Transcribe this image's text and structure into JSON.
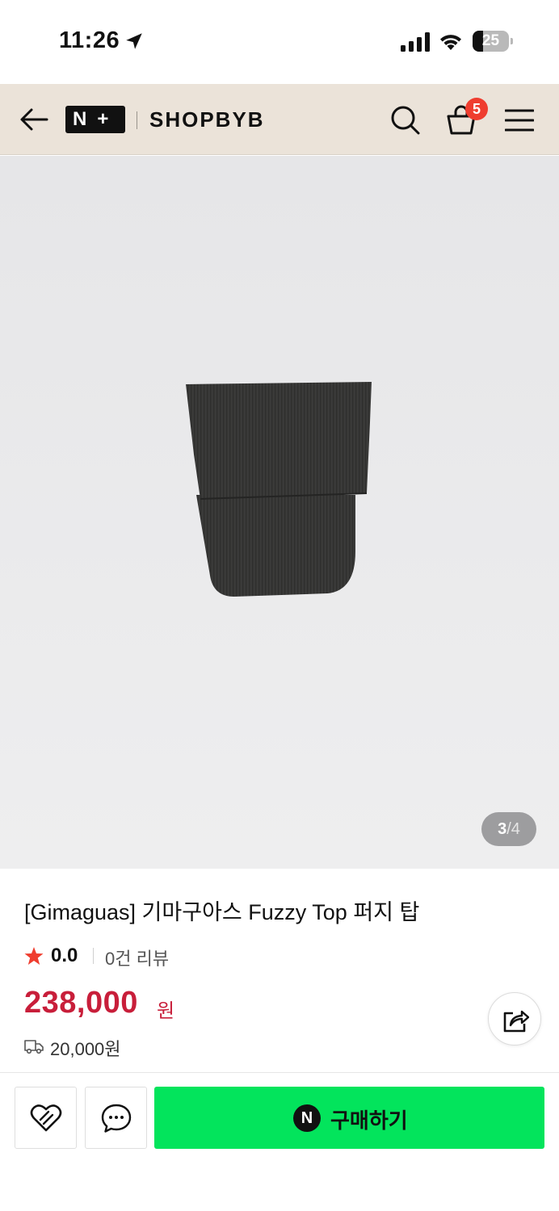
{
  "status_bar": {
    "time": "11:26",
    "battery": "25"
  },
  "header": {
    "logo": "N+",
    "brand": "SHOPBYB",
    "cart_count": "5"
  },
  "gallery": {
    "current": "3",
    "separator": "/",
    "total": "4"
  },
  "product": {
    "title": "[Gimaguas] 기마구아스 Fuzzy Top 퍼지 탑",
    "rating": "0.0",
    "reviews": "0건 리뷰",
    "price": "238,000",
    "price_unit": "원",
    "shipping_fee": "20,000원"
  },
  "actions": {
    "buy_label": "구매하기",
    "npay_badge": "N"
  },
  "colors": {
    "accent_price": "#c81e3a",
    "buy_button": "#03e45c",
    "header_bg": "#ebe3d9",
    "badge": "#ef3d2f"
  }
}
